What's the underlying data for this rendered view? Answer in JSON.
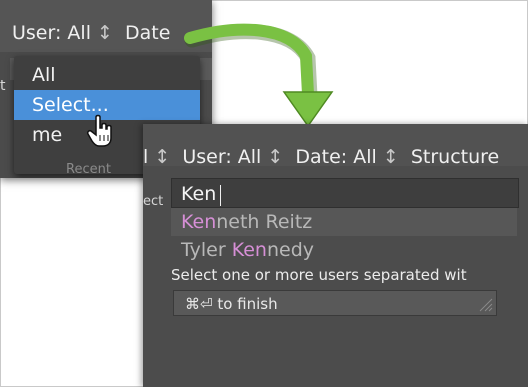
{
  "panelA": {
    "filter": {
      "user_label": "User: All",
      "user_sep": "↕",
      "date_label": "Date"
    },
    "left_fragment": "t",
    "menu": {
      "items": [
        "All",
        "Select...",
        "me"
      ],
      "selected_index": 1,
      "partial_below": "Recent"
    }
  },
  "panelB": {
    "filter": {
      "lead": "l",
      "lead_sep": "↕",
      "user_label": "User: All",
      "user_sep": "↕",
      "date_label": "Date: All",
      "date_sep": "↕",
      "structure_label": "Structure"
    },
    "left_fragment": "ect",
    "search": {
      "value": "Ken"
    },
    "suggestions": [
      {
        "match": "Ken",
        "rest": "neth Reitz",
        "prefix": ""
      },
      {
        "prefix": "Tyler ",
        "match": "Ken",
        "rest": "nedy"
      }
    ],
    "help_text": "Select one or more users separated wit",
    "finish_hint": "⌘⏎ to finish"
  },
  "colors": {
    "selected_item": "#4a90d9",
    "match_highlight": "#d68fd6",
    "arrow": "#7ac143",
    "panel_bg": "#4c4c4c"
  },
  "icons": {
    "cursor": "hand-pointer-icon",
    "arrow": "curved-arrow-icon",
    "resize": "resize-grip-icon"
  }
}
